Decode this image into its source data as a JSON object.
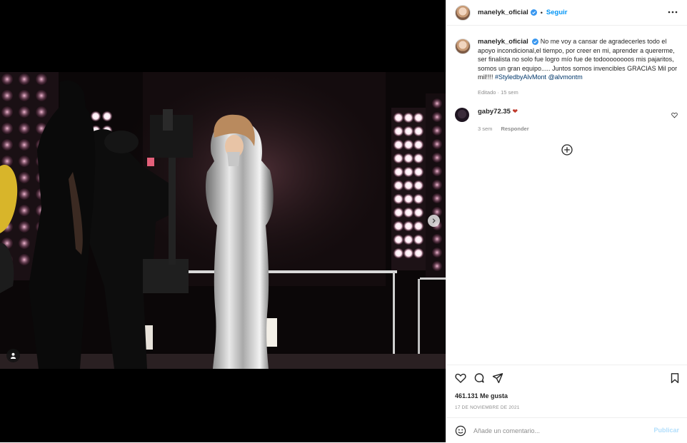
{
  "post": {
    "author": "manelyk_oficial",
    "verified": true,
    "follow_label": "Seguir",
    "separator": "•",
    "more_icon": "more-horizontal-icon"
  },
  "caption": {
    "author": "manelyk_oficial",
    "text": "No me voy a cansar de agradecerles todo el apoyo incondicional,el tiempo, por creer en mi, aprender a quererme, ser finalista no solo fue logro mío fue de todoooooooos mis pajaritos, somos un gran equipo..... Juntos somos invencibles GRACIAS Mil por mil!!!! ",
    "hashtag": "#StyledbyAlvMont",
    "mention": "@alvmontm",
    "edited": "Editado · 15 sem"
  },
  "comments": [
    {
      "author": "gaby72.35",
      "text": "❤",
      "time": "3 sem",
      "reply_label": "Responder"
    }
  ],
  "actions": {
    "likes": "461.131 Me gusta",
    "date": "17 DE NOVIEMBRE DE 2021"
  },
  "comment_box": {
    "placeholder": "Añade un comentario...",
    "publish_label": "Publicar"
  },
  "colors": {
    "link_blue": "#0095f6",
    "hashtag": "#00376b",
    "muted": "#8e8e8e",
    "publish_disabled": "#b2dffc"
  }
}
